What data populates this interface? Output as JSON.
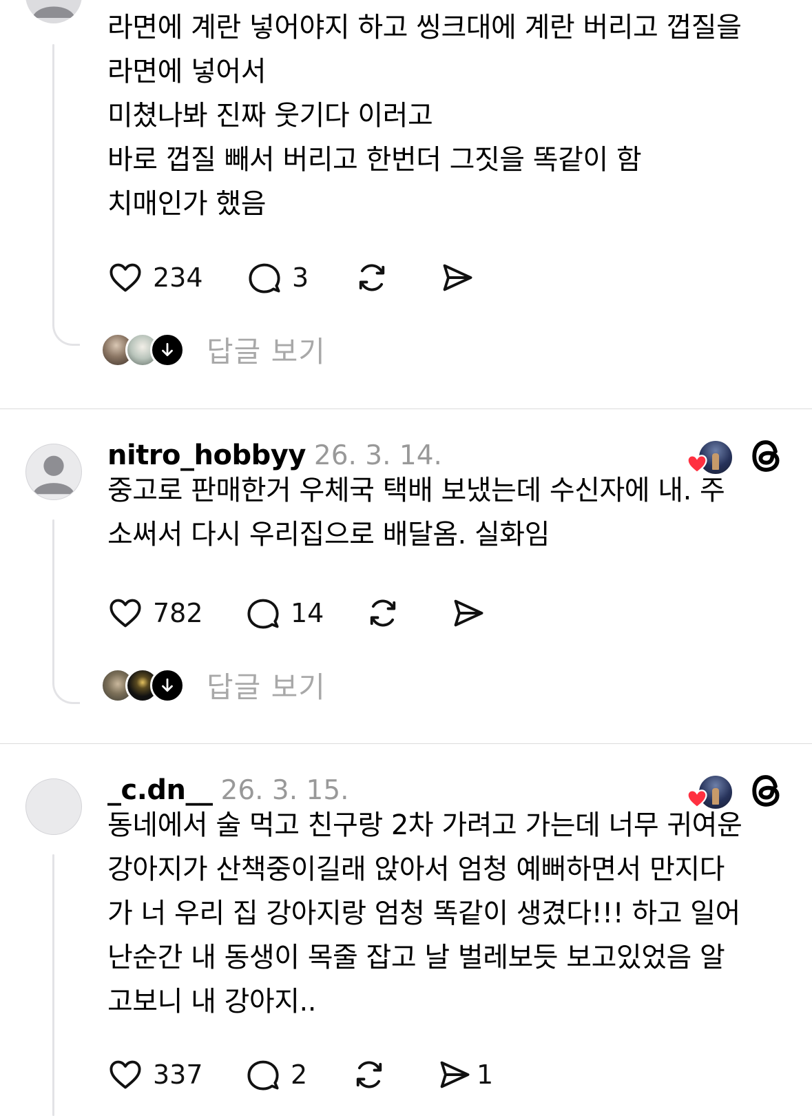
{
  "colors": {
    "text": "#000000",
    "muted": "#999999",
    "reply_label": "#a8a8a8",
    "heart_red": "#ff3040",
    "divider": "#dbdbdb",
    "thread_line": "#e3e3e6"
  },
  "posts": [
    {
      "username": "",
      "timestamp": "",
      "lines": [
        "라면에 계란 넣어야지 하고 씽크대에 계란 버리고 껍질을",
        "라면에 넣어서",
        "미쳤나봐 진짜 웃기다 이러고",
        "바로 껍질 빼서 버리고 한번더 그짓을 똑같이 함",
        "치매인가 했음"
      ],
      "likes": "234",
      "comments": "3",
      "shares": "",
      "reply_label": "답글 보기"
    },
    {
      "username": "nitro_hobbyy",
      "timestamp": "26. 3. 14.",
      "lines": [
        "중고로 판매한거 우체국 택배 보냈는데 수신자에  내. 주",
        "소써서 다시 우리집으로 배달옴. 실화임"
      ],
      "likes": "782",
      "comments": "14",
      "shares": "",
      "reply_label": "답글 보기"
    },
    {
      "username": "_c.dn__",
      "timestamp": "26. 3. 15.",
      "lines": [
        "동네에서 술 먹고 친구랑 2차 가려고 가는데 너무 귀여운",
        "강아지가 산책중이길래 앉아서 엄청 예뻐하면서 만지다",
        "가 너 우리 집 강아지랑 엄청 똑같이 생겼다!!! 하고 일어",
        "난순간 내 동생이 목줄 잡고 날 벌레보듯 보고있었음 알",
        "고보니 내 강아지.."
      ],
      "likes": "337",
      "comments": "2",
      "shares": "1",
      "reply_label": ""
    }
  ],
  "icons": [
    "heart-icon",
    "comment-icon",
    "repost-icon",
    "share-icon",
    "threads-logo-icon",
    "arrow-down-icon",
    "person-icon"
  ]
}
